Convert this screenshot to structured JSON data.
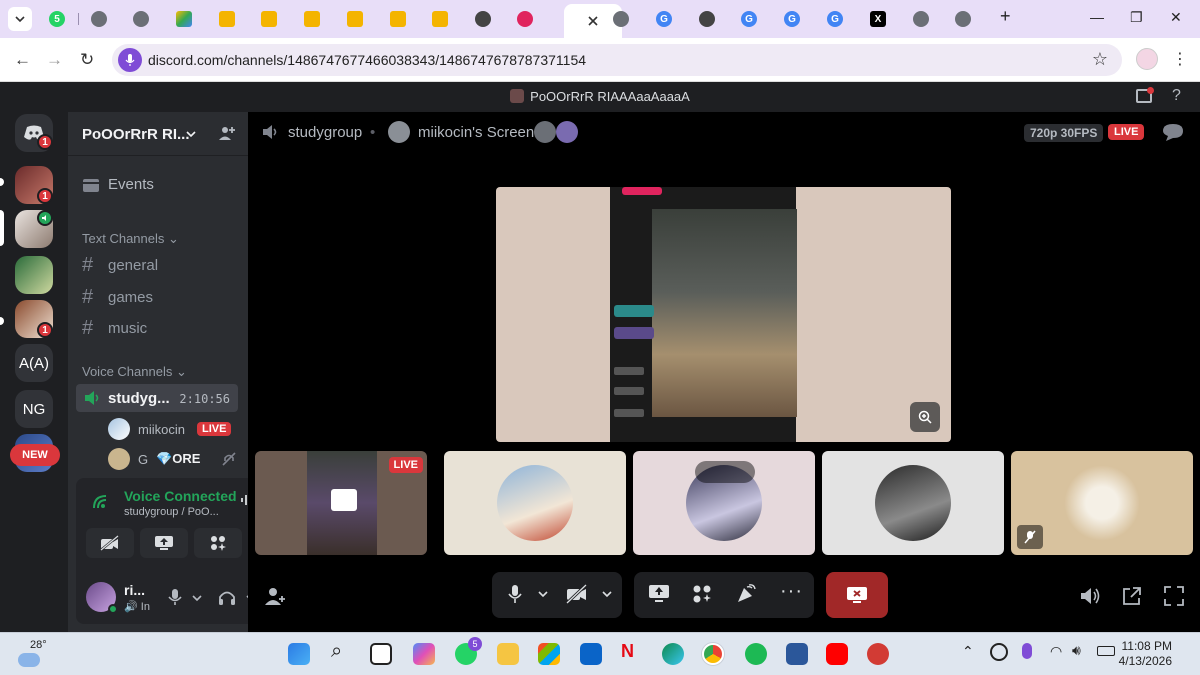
{
  "browser": {
    "url": "discord.com/channels/1486747677466038343/1486747678787371154",
    "tab_badge_count": "5"
  },
  "window_title": "PoOOrRrR RIAAAaaAaaaA",
  "rail": {
    "dm_badge": "1",
    "servers": [
      {
        "badge": "1"
      },
      {
        "badge": ""
      },
      {
        "badge": ""
      },
      {
        "badge": "1"
      }
    ],
    "text_servers": [
      "A(A)",
      "NG"
    ],
    "new_label": "NEW"
  },
  "server": {
    "name": "PoOOrRrR RI...",
    "events_label": "Events",
    "text_category": "Text Channels",
    "text_channels": [
      "general",
      "games",
      "music"
    ],
    "voice_category": "Voice Channels",
    "voice_channel": {
      "name": "studyg...",
      "elapsed": "2:10:56"
    },
    "members": [
      {
        "name": "miikocin",
        "tag": "LIVE"
      },
      {
        "name": "G",
        "suffix": "💎ORE"
      }
    ]
  },
  "voice_panel": {
    "status": "Voice Connected",
    "location": "studygroup / PoO..."
  },
  "user": {
    "name": "ri...",
    "status": "In"
  },
  "stage": {
    "channel": "studygroup",
    "screen_title": "miikocin's Screen",
    "quality": "720p 30FPS",
    "live_label": "LIVE",
    "tile_live_label": "LIVE"
  },
  "colors": {
    "accent_green": "#23a55a",
    "live_red": "#da373c",
    "end_call": "#a12828"
  },
  "taskbar": {
    "temperature": "28°",
    "whatsapp_badge": "5",
    "time": "11:08 PM",
    "date": "4/13/2026"
  }
}
